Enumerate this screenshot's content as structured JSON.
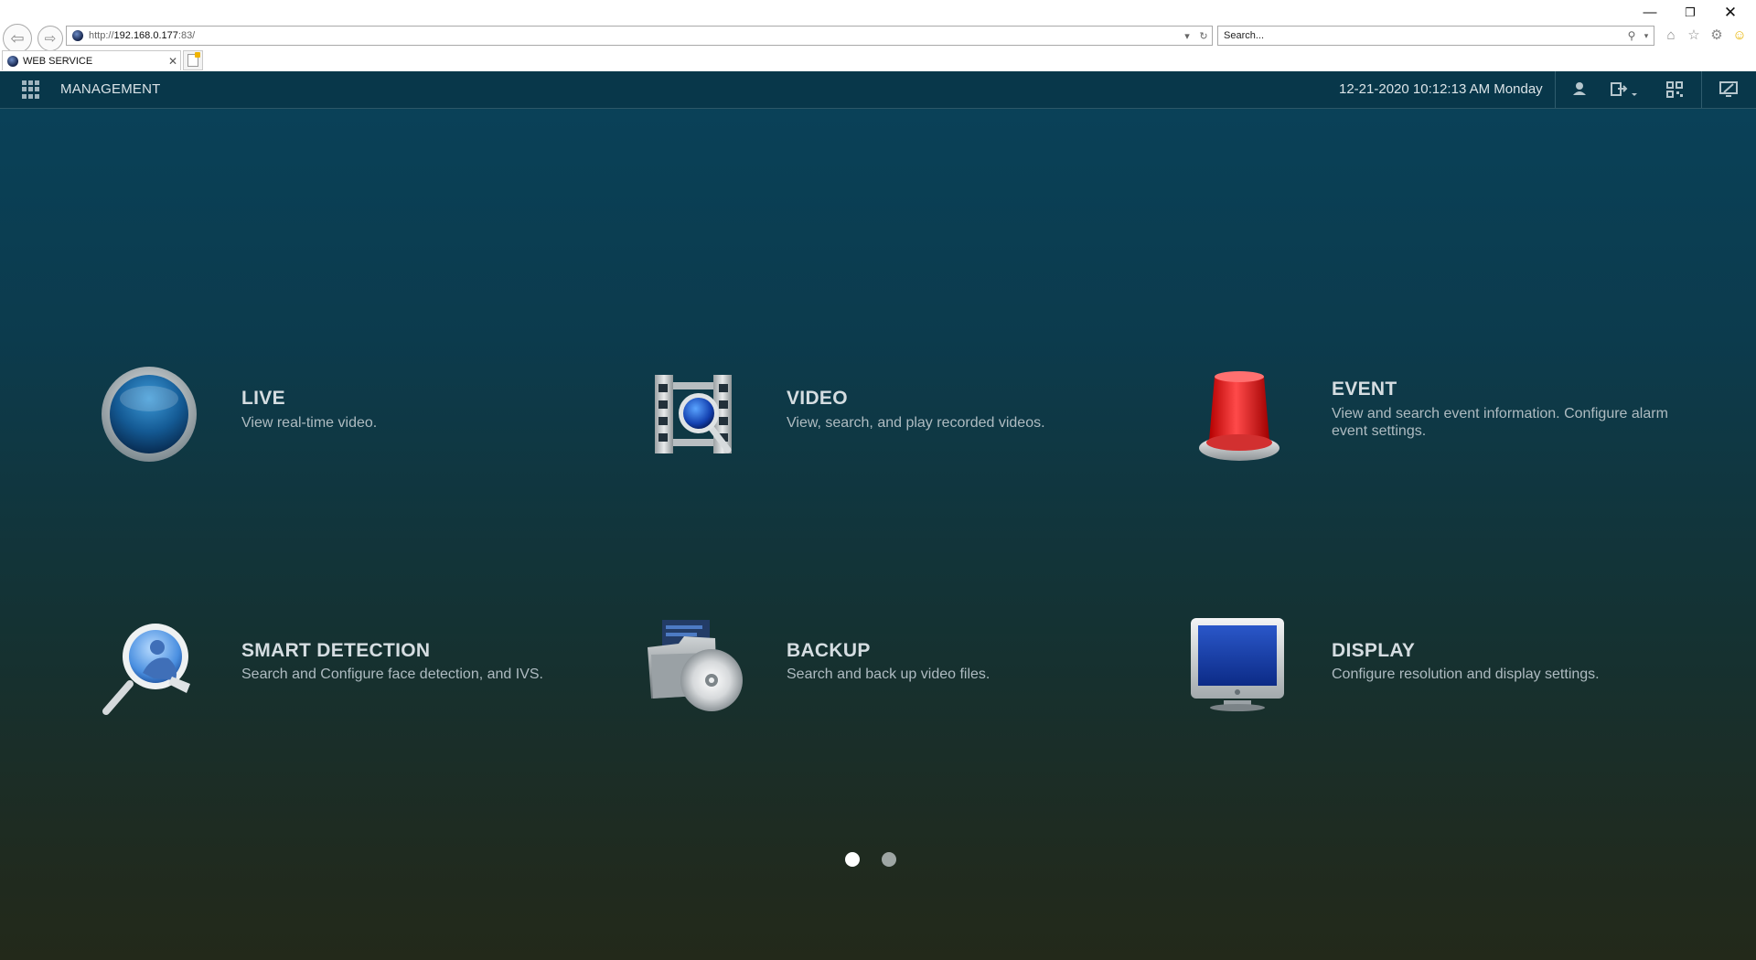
{
  "browser": {
    "url_prefix": "http://",
    "url_host": "192.168.0.177",
    "url_rest": ":83/",
    "search_placeholder": "Search...",
    "tab_title": "WEB SERVICE"
  },
  "header": {
    "title": "MANAGEMENT",
    "datetime": "12-21-2020 10:12:13 AM Monday"
  },
  "modules": [
    {
      "title": "LIVE",
      "description": "View real-time video."
    },
    {
      "title": "VIDEO",
      "description": "View, search, and play recorded videos."
    },
    {
      "title": "EVENT",
      "description": "View and search event information. Configure alarm event settings."
    },
    {
      "title": "SMART DETECTION",
      "description": "Search and Configure face detection, and IVS."
    },
    {
      "title": "BACKUP",
      "description": "Search and back up video files."
    },
    {
      "title": "DISPLAY",
      "description": "Configure resolution and display settings."
    }
  ],
  "pager": {
    "pages": 2,
    "current": 1
  },
  "icons": {
    "browser": [
      "back-icon",
      "forward-icon",
      "dropdown-icon",
      "refresh-icon",
      "search-icon",
      "home-icon",
      "star-icon",
      "gear-icon",
      "smiley-icon"
    ],
    "header": [
      "grid-icon",
      "user-icon",
      "logout-icon",
      "qr-code-icon",
      "monitor-icon"
    ]
  }
}
